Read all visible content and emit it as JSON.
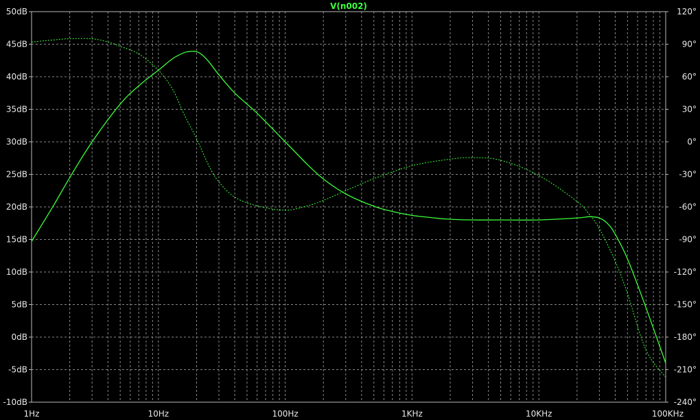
{
  "chart_data": {
    "type": "line",
    "title": "V(n002)",
    "x_scale": "log",
    "x_range_hz": [
      1,
      100000
    ],
    "x_ticks": [
      {
        "value": 1,
        "label": "1Hz"
      },
      {
        "value": 10,
        "label": "10Hz"
      },
      {
        "value": 100,
        "label": "100Hz"
      },
      {
        "value": 1000,
        "label": "1KHz"
      },
      {
        "value": 10000,
        "label": "10KHz"
      },
      {
        "value": 100000,
        "label": "100KHz"
      }
    ],
    "y_left_range_db": [
      -10,
      50
    ],
    "y_left_ticks": [
      {
        "value": 50,
        "label": "50dB"
      },
      {
        "value": 45,
        "label": "45dB"
      },
      {
        "value": 40,
        "label": "40dB"
      },
      {
        "value": 35,
        "label": "35dB"
      },
      {
        "value": 30,
        "label": "30dB"
      },
      {
        "value": 25,
        "label": "25dB"
      },
      {
        "value": 20,
        "label": "20dB"
      },
      {
        "value": 15,
        "label": "15dB"
      },
      {
        "value": 10,
        "label": "10dB"
      },
      {
        "value": 5,
        "label": "5dB"
      },
      {
        "value": 0,
        "label": "0dB"
      },
      {
        "value": -5,
        "label": "-5dB"
      },
      {
        "value": -10,
        "label": "-10dB"
      }
    ],
    "y_right_range_deg": [
      -240,
      120
    ],
    "y_right_ticks": [
      {
        "value": 120,
        "label": "120°"
      },
      {
        "value": 90,
        "label": "90°"
      },
      {
        "value": 60,
        "label": "60°"
      },
      {
        "value": 30,
        "label": "30°"
      },
      {
        "value": 0,
        "label": "0°"
      },
      {
        "value": -30,
        "label": "-30°"
      },
      {
        "value": -60,
        "label": "-60°"
      },
      {
        "value": -90,
        "label": "-90°"
      },
      {
        "value": -120,
        "label": "-120°"
      },
      {
        "value": -150,
        "label": "-150°"
      },
      {
        "value": -180,
        "label": "-180°"
      },
      {
        "value": -210,
        "label": "-210°"
      },
      {
        "value": -240,
        "label": "-240°"
      }
    ],
    "grid": true,
    "colors": {
      "background": "#000000",
      "trace": "#3cff3c",
      "grid": "#8a8a8a",
      "text": "#e8e8e8"
    },
    "magnitude_db": {
      "x": [
        1,
        1.5,
        2,
        3,
        5,
        7,
        10,
        13,
        16,
        18,
        20,
        22,
        25,
        30,
        40,
        60,
        100,
        150,
        200,
        300,
        500,
        700,
        1000,
        1500,
        2000,
        3000,
        5000,
        10000,
        20000,
        25000,
        30000,
        35000,
        40000,
        50000,
        70000,
        100000
      ],
      "y": [
        14.7,
        20.3,
        24.5,
        30.0,
        35.8,
        38.6,
        41.0,
        42.8,
        43.7,
        43.9,
        43.85,
        43.4,
        42.3,
        40.3,
        37.5,
        34.4,
        30.0,
        26.5,
        24.3,
        22.0,
        20.1,
        19.3,
        18.7,
        18.3,
        18.1,
        18.0,
        18.0,
        18.0,
        18.3,
        18.5,
        18.3,
        17.4,
        15.8,
        12.0,
        4.5,
        -4.0
      ]
    },
    "phase_deg": {
      "x": [
        1,
        1.5,
        2,
        3,
        4,
        5,
        7,
        10,
        13,
        16,
        20,
        25,
        30,
        40,
        60,
        100,
        150,
        200,
        300,
        500,
        1000,
        2000,
        3000,
        5000,
        10000,
        20000,
        25000,
        30000,
        40000,
        50000,
        70000,
        100000
      ],
      "y": [
        92,
        94,
        95,
        95,
        92,
        88,
        81,
        66,
        48,
        25,
        3,
        -22,
        -37,
        -51,
        -59,
        -63,
        -59,
        -54,
        -45,
        -34,
        -22,
        -16,
        -14.5,
        -17,
        -31,
        -55,
        -67,
        -80,
        -110,
        -140,
        -192,
        -217
      ]
    }
  }
}
